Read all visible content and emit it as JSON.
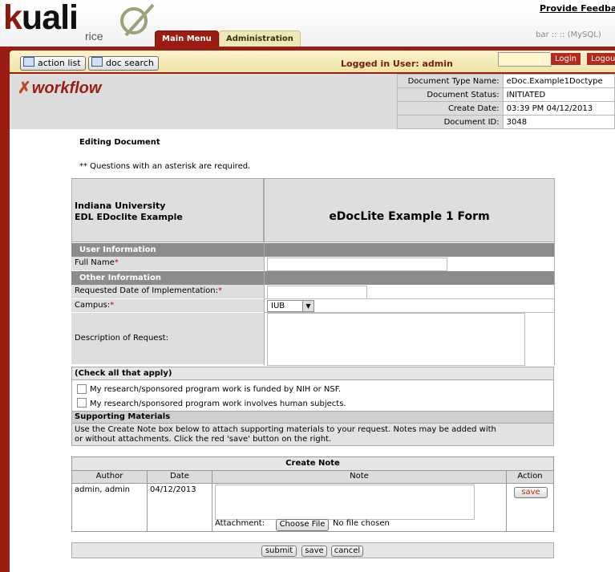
{
  "header": {
    "logo_text": "kuali",
    "logo_sub": "rice",
    "feedback_link": "Provide Feedback",
    "environment": "bar :: :: (MySQL)",
    "tabs": [
      {
        "label": "Main Menu",
        "active": true
      },
      {
        "label": "Administration",
        "active": false
      }
    ]
  },
  "toolbar": {
    "action_list": "action list",
    "doc_search": "doc search",
    "logged_in": "Logged in User: admin",
    "login_value": "",
    "login_button": "Login",
    "logout_button": "Logout"
  },
  "workflow_logo": "workflow",
  "doc_info": [
    {
      "label": "Document Type Name:",
      "value": "eDoc.Example1Doctype"
    },
    {
      "label": "Document Status:",
      "value": "INITIATED"
    },
    {
      "label": "Create Date:",
      "value": "03:39 PM 04/12/2013"
    },
    {
      "label": "Document ID:",
      "value": "3048"
    }
  ],
  "page": {
    "editing": "Editing Document",
    "required_note": "** Questions with an asterisk are required."
  },
  "form": {
    "org_line1": "Indiana University",
    "org_line2": "EDL EDoclite Example",
    "form_title": "eDocLite Example 1 Form",
    "user_info_header": "User Information",
    "full_name_label": "Full Name",
    "full_name_value": "",
    "other_info_header": "Other Information",
    "req_date_label": "Requested Date of Implementation:",
    "req_date_value": "",
    "campus_label": "Campus:",
    "campus_value": "IUB",
    "description_label": "Description of Request:",
    "description_value": "",
    "required_mark": "*",
    "check_header": "(Check all that apply)",
    "check1_label": "My research/sponsored program work is funded by NIH or NSF.",
    "check1_checked": false,
    "check2_label": "My research/sponsored program work involves human subjects.",
    "check2_checked": false,
    "supporting_header": "Supporting Materials",
    "supporting_text1": "Use the Create Note box below to attach supporting materials to your request. Notes may be added with",
    "supporting_text2": "or without attachments. Click the red 'save' button on the right."
  },
  "note": {
    "title": "Create Note",
    "columns": [
      "Author",
      "Date",
      "Note",
      "Action"
    ],
    "author": "admin, admin",
    "date": "04/12/2013",
    "note_value": "",
    "attachment_label": "Attachment:",
    "choose_file": "Choose File",
    "no_file": "No file chosen",
    "save": "save"
  },
  "actions": {
    "submit": "submit",
    "save": "save",
    "cancel": "cancel"
  },
  "colors": {
    "brand_red": "#9a1c12",
    "tab_active": "#9a1c12",
    "tab_inactive": "#efe8b9",
    "toolbar_bg": "#fbf3cc"
  }
}
